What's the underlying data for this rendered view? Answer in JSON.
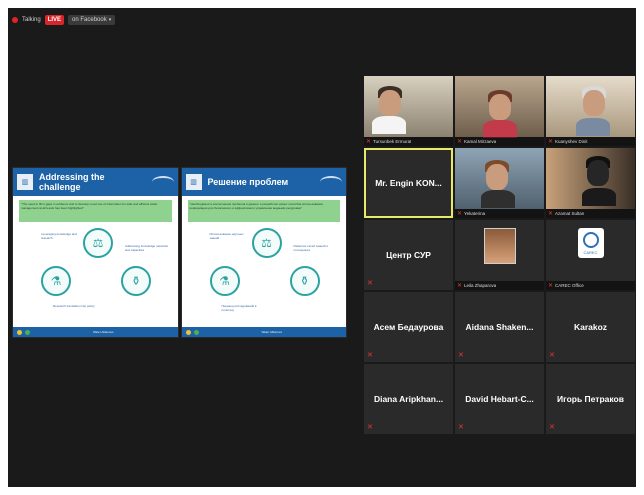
{
  "topbar": {
    "recording_label": "Talking",
    "live_label": "LIVE",
    "destination_label": "on Facebook"
  },
  "share": {
    "slides": [
      {
        "title": "Addressing the challenge",
        "quote": "\"The need to fill in gaps in evidence and to develop novel use of information for safe and efficient water management at all levels has been highlighted\"",
        "notes": [
          "Leveraging knowledge and research",
          "Addressing knowledge networks and capacities",
          "Research translation into policy"
        ],
        "footer": "Water Alliances"
      },
      {
        "title": "Решение проблем",
        "quote": "\"Необходимость восполнения пробелов в данных и разработки новых способов использования информации для безопасного и эффективного управления водными ресурсами\"",
        "notes": [
          "Использование научных знаний",
          "Развитие сетей знаний и потенциала",
          "Перевод исследований в политику"
        ],
        "footer": "Water Alliances"
      }
    ]
  },
  "gallery": {
    "tiles": [
      {
        "name": "Tursunbek Ermurat",
        "style": "video-label"
      },
      {
        "name": "Kamal Mirzaeva",
        "style": "video-label"
      },
      {
        "name": "Kuanyshev Dinit",
        "style": "video-label"
      },
      {
        "name": "Mr. Engin KON...",
        "style": "name-active"
      },
      {
        "name": "Yekaterina",
        "style": "video-label"
      },
      {
        "name": "Azamat Sultan",
        "style": "video-label"
      },
      {
        "name": "Центр СУР",
        "style": "name"
      },
      {
        "name": "Leila Zhaparova",
        "style": "photo"
      },
      {
        "name": "CAREC Office",
        "style": "logo"
      },
      {
        "name": "Асем Бедаурова",
        "style": "name"
      },
      {
        "name": "Aidana Shaken...",
        "style": "name"
      },
      {
        "name": "Karakoz",
        "style": "name"
      },
      {
        "name": "Diana Aripkhan...",
        "style": "name"
      },
      {
        "name": "David Hebart-C...",
        "style": "name"
      },
      {
        "name": "Игорь Петраков",
        "style": "name"
      }
    ],
    "logo_text": "CAREC"
  },
  "icons": {
    "muted_mic": "muted-mic-icon",
    "caret": "chevron-down-icon"
  },
  "colors": {
    "live": "#d9262a",
    "slide_header": "#1d62a6",
    "active_outline": "#e8e86a",
    "muted": "#e53935"
  }
}
